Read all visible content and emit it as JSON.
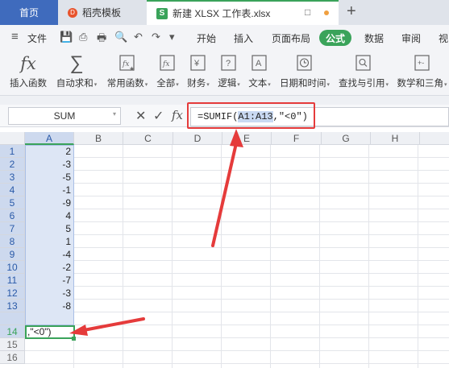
{
  "tabs": {
    "home": "首页",
    "doc": "稻壳模板",
    "doc_logo": "D",
    "file": "新建 XLSX 工作表.xlsx",
    "file_logo": "S",
    "window_icon": "□",
    "new_tab": "+"
  },
  "menu": {
    "hamburger": "≡",
    "file": "文件",
    "quick_icons": [
      "💾",
      "⎙",
      "🖶",
      "🔍",
      "↶",
      "↷",
      "▾"
    ],
    "items": [
      "开始",
      "插入",
      "页面布局",
      "公式",
      "数据",
      "审阅",
      "视"
    ],
    "active": "公式"
  },
  "ribbon": {
    "buttons": [
      {
        "label": "插入函数",
        "icon": "fx-icon",
        "dropdown": false
      },
      {
        "label": "自动求和",
        "icon": "sigma-icon",
        "dropdown": true
      },
      {
        "label": "常用函数",
        "icon": "star-function-icon",
        "dropdown": true
      },
      {
        "label": "全部",
        "icon": "fx-box-icon",
        "dropdown": true
      },
      {
        "label": "财务",
        "icon": "yen-icon",
        "dropdown": true
      },
      {
        "label": "逻辑",
        "icon": "question-icon",
        "dropdown": true
      },
      {
        "label": "文本",
        "icon": "text-a-icon",
        "dropdown": true
      },
      {
        "label": "日期和时间",
        "icon": "clock-icon",
        "dropdown": true
      },
      {
        "label": "查找与引用",
        "icon": "lookup-icon",
        "dropdown": true
      },
      {
        "label": "数学和三角",
        "icon": "math-icon",
        "dropdown": true
      }
    ],
    "caret": "▾",
    "glyphs": {
      "sigma": "∑",
      "fx": "fx",
      "yen": "¥",
      "question": "?",
      "text": "A",
      "math": "+-"
    }
  },
  "formula_bar": {
    "name_box": "SUM",
    "name_box_dropdown": "▾",
    "cancel": "✕",
    "confirm": "✓",
    "fx": "fx",
    "formula_prefix": "=SUMIF(",
    "formula_ref": "A1:A13",
    "formula_suffix": ",\"<0\")"
  },
  "grid": {
    "columns": [
      "A",
      "B",
      "C",
      "D",
      "E",
      "F",
      "G",
      "H"
    ],
    "rows": [
      "1",
      "2",
      "3",
      "4",
      "5",
      "6",
      "7",
      "8",
      "9",
      "10",
      "11",
      "12",
      "13",
      "14",
      "15",
      "16"
    ],
    "values_col_a": [
      "2",
      "-3",
      "-5",
      "-1",
      "-9",
      "4",
      "5",
      "1",
      "-4",
      "-2",
      "-7",
      "-3",
      "-8"
    ],
    "editing_cell": "A14",
    "editing_cell_text": ",\"<0\")"
  },
  "colors": {
    "accent_green": "#3aa35a",
    "tab_blue": "#3f6bbd",
    "annotation_red": "#e53b3b",
    "selection_blue": "#dde6f5"
  }
}
